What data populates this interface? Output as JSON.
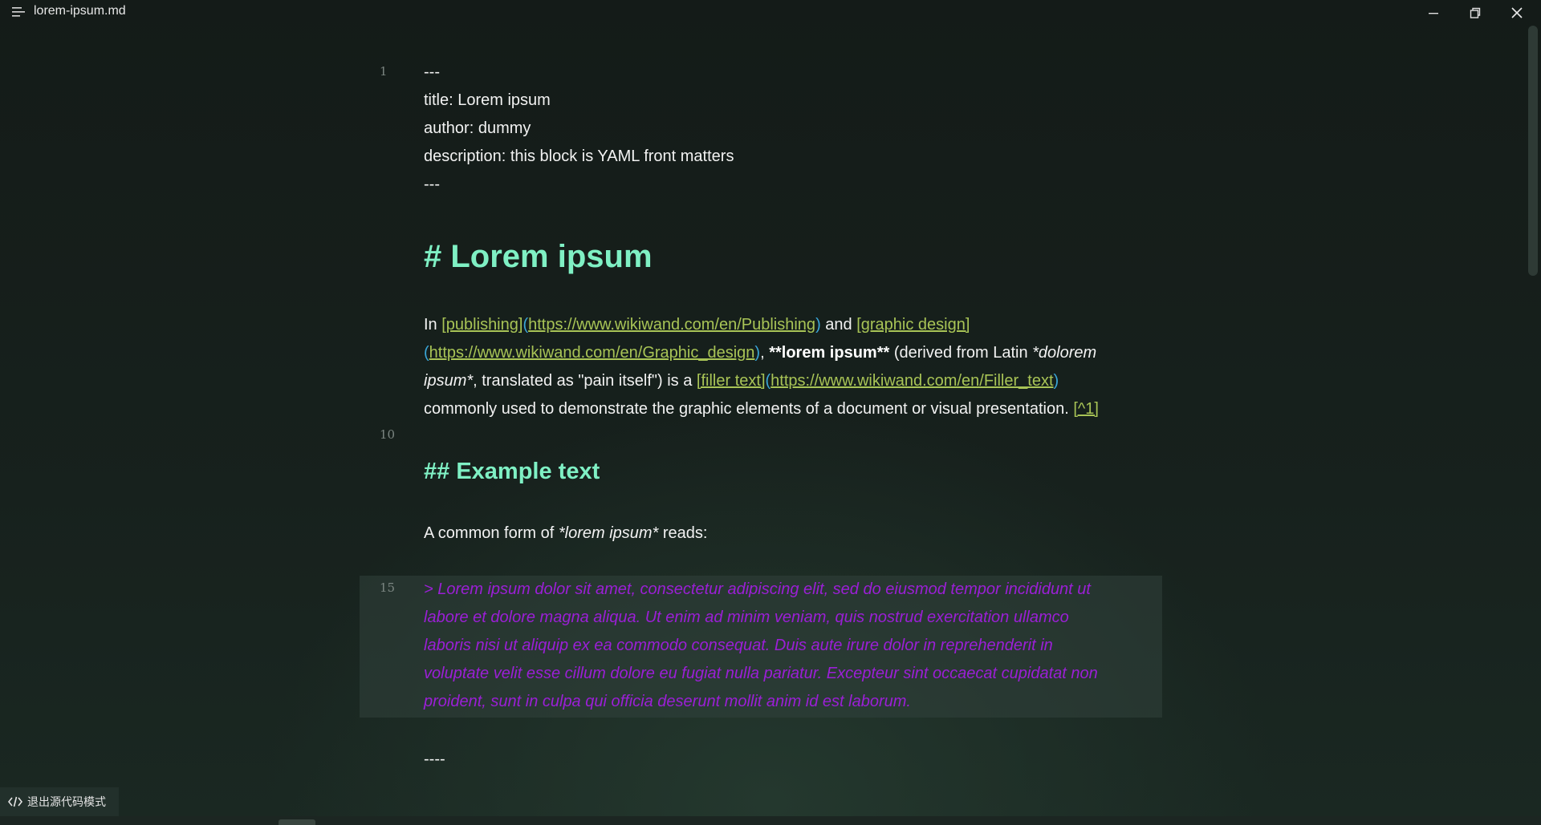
{
  "window": {
    "title": "lorem-ipsum.md",
    "controls": {
      "minimize": "minimize-icon",
      "maximize": "restore-icon",
      "close": "close-icon"
    }
  },
  "editor": {
    "line_numbers": [
      "1",
      "10",
      "15"
    ],
    "front_matter": {
      "open": "---",
      "title_line": "title: Lorem ipsum",
      "author_line": "author: dummy",
      "description_line": "description: this block is YAML front matters",
      "close": "---"
    },
    "heading1": "# Lorem ipsum",
    "paragraph": {
      "in": "In ",
      "publishing_text": "[publishing]",
      "publishing_url": "https://www.wikiwand.com/en/Publishing",
      "and": " and ",
      "graphic_text": "[graphic design]",
      "graphic_url": "https://www.wikiwand.com/en/Graphic_design",
      "comma": ", ",
      "bold": "**lorem ipsum**",
      "derived": " (derived from Latin ",
      "italic_1": "*dolorem",
      "italic_2": "ipsum*",
      "translated": ", translated as \"pain itself\") is a ",
      "filler_text": "[filler text]",
      "filler_url": "https://www.wikiwand.com/en/Filler_text",
      "close_paren": ")",
      "last_line": "commonly used to demonstrate the graphic elements of a document or visual presentation. ",
      "footnote": "[^1]"
    },
    "heading2": "## Example text",
    "common_form": {
      "before": "A common form of ",
      "italic": "*lorem ipsum*",
      "after": " reads:"
    },
    "blockquote": [
      ">  Lorem ipsum dolor sit amet, consectetur adipiscing elit, sed do eiusmod tempor incididunt ut",
      "labore et dolore magna aliqua. Ut enim ad minim veniam, quis nostrud exercitation ullamco",
      "laboris nisi ut aliquip ex ea commodo consequat. Duis aute irure dolor in reprehenderit in",
      "voluptate velit esse cillum dolore eu fugiat nulla pariatur. Excepteur sint occaecat cupidatat non",
      "proident, sunt in culpa qui officia deserunt mollit anim id est laborum."
    ],
    "hr": "----"
  },
  "statusbar": {
    "icon": "code-icon",
    "label": "退出源代码模式"
  },
  "colors": {
    "heading": "#7ff0c4",
    "link": "#a8c456",
    "paren": "#3aa6d8",
    "quote": "#9b1fd6",
    "background": "#141b18"
  }
}
